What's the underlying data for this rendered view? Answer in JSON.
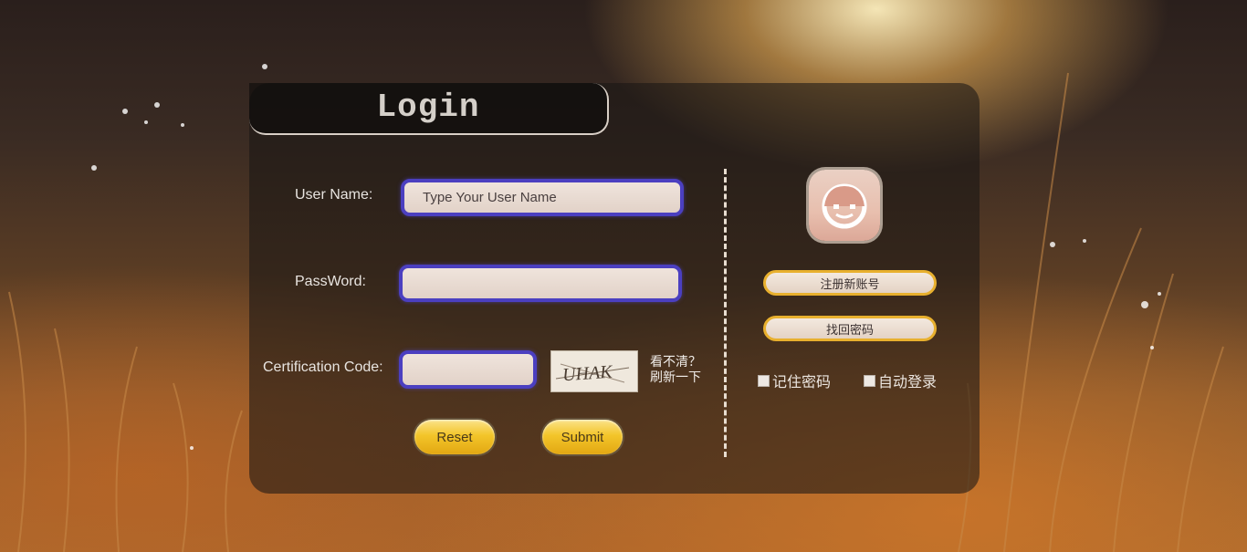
{
  "title": "Login",
  "form": {
    "username_label": "User Name:",
    "username_placeholder": "Type Your User Name",
    "password_label": "PassWord:",
    "password_value": "",
    "cert_label": "Certification Code:",
    "cert_value": "",
    "captcha_text": "UHAK",
    "refresh_line1": "看不清？",
    "refresh_line2": "刷新一下",
    "reset_label": "Reset",
    "submit_label": "Submit"
  },
  "side": {
    "register_label": "注册新账号",
    "recover_label": "找回密码",
    "remember_label": "记住密码",
    "auto_login_label": "自动登录"
  },
  "colors": {
    "field_border": "#4b3fc0",
    "button_gold": "#f3c52a",
    "pill_border": "#e8b02e"
  }
}
